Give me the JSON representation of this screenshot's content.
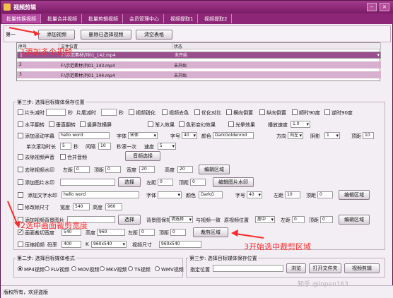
{
  "window": {
    "title": "视频剪辑"
  },
  "tabs": [
    "批量转换视频",
    "批量合并视频",
    "批量剪辑视频",
    "会员管理中心",
    "视频提取1",
    "视频提取2"
  ],
  "step1": {
    "label": "第一",
    "add": "添加视频",
    "remove": "删除已选择视频",
    "clear": "清空表格"
  },
  "table": {
    "headers": [
      "序号",
      "文件位置",
      "状态"
    ],
    "rows": [
      {
        "idx": "1",
        "path": "F:\\示范素材\\列01_142.mp4",
        "status": "未开始"
      },
      {
        "idx": "2",
        "path": "F:\\示范素材\\列01_143.mp4",
        "status": "未开始"
      },
      {
        "idx": "3",
        "path": "F:\\示范素材\\列01_144.mp4",
        "status": "未开始"
      }
    ]
  },
  "step3": {
    "label": "第三步: 选择目标媒体保存位置",
    "r1": {
      "trim_head": "片头减时",
      "sec1": "秒",
      "trim_tail": "片尾减时",
      "sec2": "秒",
      "sharpen": "视频锐化",
      "decolor": "视频去色",
      "optimize": "优化对比",
      "hflip": "横向倒置",
      "vflip": "纵向倒置",
      "cw90": "顺时90度",
      "ccw90": "逆时90度"
    },
    "r2": {
      "hmirror": "水平翻转",
      "vmirror": "垂直翻转",
      "vscreen": "竖屏改横屏",
      "fadein": "渐入效果",
      "colorchange": "色彩变幻效果",
      "lighting": "光晕效果",
      "speed_label": "播放速度",
      "speed": "1.0"
    },
    "r3": {
      "subtitle": "添加滚动字幕",
      "text": "hello word",
      "font_label": "字体",
      "font": "宋体",
      "size_label": "字号",
      "size": "40",
      "color_label": "颜色",
      "color": "DarkGoldenrod",
      "dir_label": "方向",
      "dir": "向左",
      "shadow_label": "阴影",
      "shadow": "1",
      "top_label": "顶距",
      "top": "10"
    },
    "r4": {
      "single": "单次滚动时长",
      "single_val": "5",
      "sec": "秒",
      "interval": "间隔",
      "interval_val": "10",
      "per": "秒滚一次",
      "speed": "速度",
      "speed_val": "5"
    },
    "r5": {
      "remove_audio": "去除视频声音",
      "merge_audio": "合并音频",
      "choose_audio": "音频选择"
    },
    "r6": {
      "remove_wm": "去除视频水印",
      "left": "左距",
      "left_val": "0",
      "top": "顶距",
      "top_val": "0",
      "width": "宽度",
      "width_val": "20",
      "height": "高度",
      "height_val": "20",
      "edit": "编辑区域"
    },
    "r7": {
      "add_img_wm": "添加图片水印",
      "choose": "选择",
      "left": "左距",
      "left_val": "0",
      "top": "顶距",
      "top_val": "0",
      "edit": "编辑图片水印"
    },
    "r8": {
      "add_text_wm": "添加文字水印",
      "text": "hello word",
      "font": "字体",
      "color": "颜色",
      "color_val": "DarkG",
      "size": "字号",
      "size_val": "40",
      "left": "左距",
      "left_val": "10",
      "top": "顶距",
      "top_val": "0",
      "edit": "编辑区域"
    },
    "r9": {
      "modify_size": "修改帧尺寸",
      "w": "宽度",
      "w_val": "540",
      "h": "高度",
      "h_val": "960"
    },
    "r10": {
      "bg_img": "添加视频背景图片",
      "choose": "选择",
      "bg_pos": "背景图保持",
      "pos_val": "请选择",
      "consistent": "与视频一致",
      "orig_pos": "原视频位置",
      "orig_val": "居中",
      "left": "左距",
      "left_val": "0",
      "top": "顶距",
      "top_val": "0",
      "edit": "编辑区域"
    },
    "r11": {
      "crop": "画面裁切宽度",
      "w_val": "540",
      "h": "高度",
      "h_val": "960",
      "left": "左距",
      "left_val": "0",
      "top": "顶距",
      "top_val": "0",
      "crop_btn": "裁剪区域"
    },
    "r12": {
      "compress": "压缩视频",
      "rate": "码率",
      "rate_val": "400",
      "k": "K",
      "res": "960x540",
      "vsize": "视频尺寸",
      "vsize_val": "960x540"
    }
  },
  "step2": {
    "label": "第二步: 选择目标媒体格式",
    "formats": [
      "MP4视频",
      "FLV视频",
      "MOV视频",
      "MKV视频",
      "TS视频",
      "WMV视频"
    ]
  },
  "save": {
    "label": "第三步: 选择目标媒体保存位置",
    "loc": "指定位置",
    "browse": "浏览",
    "open": "打开文件夹",
    "start": "视频剪辑"
  },
  "status": {
    "text": "版权所有，欢迎盗版"
  },
  "annotations": {
    "a1": "1添加多个视频",
    "a2": "2选中画面裁剪宽度",
    "a3": "3开始选中裁剪区域"
  },
  "watermark": "知乎 @lopen163"
}
